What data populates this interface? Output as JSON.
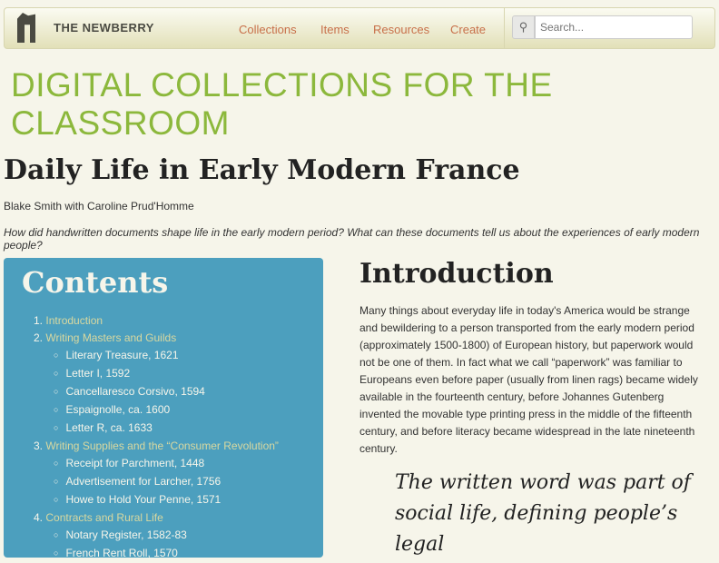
{
  "nav": {
    "brand": "THE NEWBERRY",
    "links": [
      "Collections",
      "Items",
      "Resources",
      "Create"
    ],
    "search_placeholder": "Search..."
  },
  "banner": "DIGITAL COLLECTIONS FOR THE CLASSROOM",
  "title": "Daily Life in Early Modern France",
  "authors": "Blake Smith with Caroline Prud'Homme",
  "question": "How did handwritten documents shape life in the early modern period? What can these documents tell us about the experiences of early modern people?",
  "contents": {
    "heading": "Contents",
    "sections": [
      {
        "num": "1.",
        "label": "Introduction",
        "items": []
      },
      {
        "num": "2.",
        "label": "Writing Masters and Guilds",
        "items": [
          "Literary Treasure, 1621",
          "Letter I, 1592",
          "Cancellaresco Corsivo, 1594",
          "Espaignolle, ca. 1600",
          "Letter R, ca. 1633"
        ]
      },
      {
        "num": "3.",
        "label": "Writing Supplies and the “Consumer Revolution”",
        "items": [
          "Receipt for Parchment, 1448",
          "Advertisement for Larcher, 1756",
          "Howe to Hold Your Penne, 1571"
        ]
      },
      {
        "num": "4.",
        "label": "Contracts and Rural Life",
        "items": [
          "Notary Register, 1582-83",
          "French Rent Roll, 1570"
        ]
      }
    ]
  },
  "intro": {
    "heading": "Introduction",
    "body": "Many things about everyday life in today's America would be strange and bewildering to a person transported from the early modern period (approximately 1500-1800) of European history, but paperwork would not be one of them. In fact what we call “paperwork” was familiar to Europeans even before paper (usually from linen rags) became widely available in the fourteenth century, before Johannes Gutenberg invented the movable type printing press in the middle of the fifteenth century, and before literacy became widespread in the late nineteenth century.",
    "quote": "The written word was part of social life, defining people’s legal"
  }
}
